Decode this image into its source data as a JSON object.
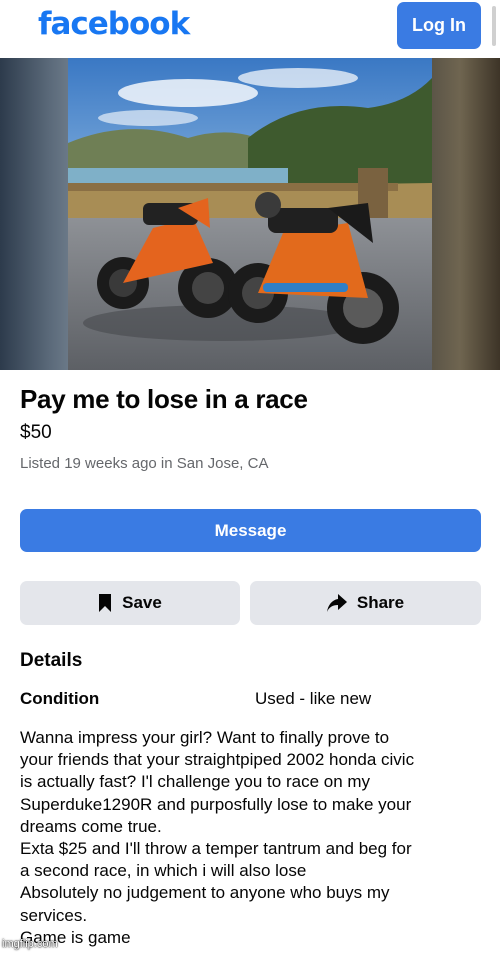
{
  "header": {
    "logo_text": "facebook",
    "login_label": "Log In"
  },
  "listing": {
    "title": "Pay me to lose in a race",
    "price": "$50",
    "listed_meta": "Listed 19 weeks ago in San Jose, CA",
    "photo_icon": "motorcycles-photo"
  },
  "actions": {
    "message_label": "Message",
    "save_label": "Save",
    "share_label": "Share"
  },
  "details": {
    "heading": "Details",
    "condition_label": "Condition",
    "condition_value": "Used - like new",
    "description_lines": [
      "Wanna impress your girl? Want to finally prove to",
      "your friends that your straightpiped 2002 honda civic",
      "is actually fast? I'l challenge you to race on my",
      "Superduke1290R and purposfully lose to make your",
      "dreams come true.",
      "Exta $25 and I'll throw a temper tantrum and beg for",
      "a second race, in which i will also lose",
      "Absolutely no judgement to anyone who buys my",
      "services.",
      "Game is game"
    ]
  },
  "watermark": "imgflip.com",
  "colors": {
    "brand": "#1877f2",
    "button_primary": "#3a7be3",
    "button_secondary": "#e4e6eb",
    "meta_text": "#65676b"
  }
}
